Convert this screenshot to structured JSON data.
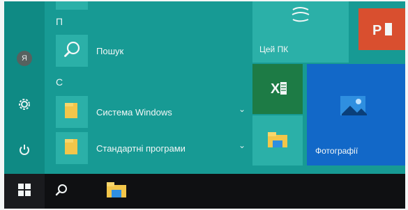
{
  "rail": {
    "avatar_letter": "Я",
    "items": [
      {
        "name": "user-avatar"
      },
      {
        "name": "settings-icon"
      },
      {
        "name": "power-icon"
      }
    ]
  },
  "apps": {
    "section_p": "П",
    "search_label": "Пошук",
    "section_s": "С",
    "system_label": "Система Windows",
    "standard_label": "Стандартні програми",
    "expand_glyph": "⌄"
  },
  "tiles": {
    "this_pc_label": "Цей ПК",
    "photos_label": "Фотографії",
    "powerpoint_glyph": "P",
    "excel_glyph": "X"
  },
  "colors": {
    "teal": "#179a94",
    "teal_dark": "#0f8a84",
    "tile_teal": "#2bb0a8",
    "excel_green": "#1d7b45",
    "powerpoint_red": "#d94f2f",
    "photos_blue": "#1268c8",
    "folder_yellow": "#f2c64a",
    "taskbar": "#0f1012"
  }
}
